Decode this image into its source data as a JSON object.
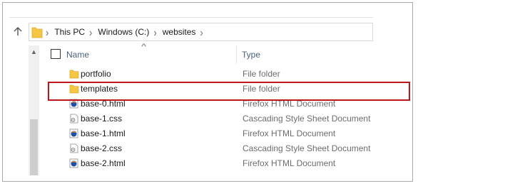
{
  "breadcrumb": [
    "This PC",
    "Windows (C:)",
    "websites"
  ],
  "columns": {
    "name": "Name",
    "type": "Type"
  },
  "files": [
    {
      "name": "portfolio",
      "type": "File folder",
      "icon": "folder-icon"
    },
    {
      "name": "templates",
      "type": "File folder",
      "icon": "folder-icon"
    },
    {
      "name": "base-0.html",
      "type": "Firefox HTML Document",
      "icon": "firefox-html-icon"
    },
    {
      "name": "base-1.css",
      "type": "Cascading Style Sheet Document",
      "icon": "css-file-icon"
    },
    {
      "name": "base-1.html",
      "type": "Firefox HTML Document",
      "icon": "firefox-html-icon"
    },
    {
      "name": "base-2.css",
      "type": "Cascading Style Sheet Document",
      "icon": "css-file-icon"
    },
    {
      "name": "base-2.html",
      "type": "Firefox HTML Document",
      "icon": "firefox-html-icon"
    }
  ],
  "highlighted_item": "templates",
  "colors": {
    "highlight": "#c0141c",
    "folder": "#f5c642",
    "header_text": "#4c607a"
  }
}
